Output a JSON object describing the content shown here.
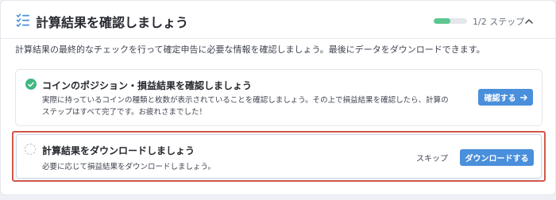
{
  "header": {
    "title": "計算結果を確認しましょう",
    "progress_fraction": 0.5,
    "step_text": "1/2 ステップ",
    "progress_color": "#5cc790"
  },
  "description": "計算結果の最終的なチェックを行って確定申告に必要な情報を確認しましょう。最後にデータをダウンロードできます。",
  "steps": [
    {
      "status": "completed",
      "title": "コインのポジション・損益結果を確認しましょう",
      "description": "実際に持っているコインの種類と枚数が表示されていることを確認しましょう。その上で損益結果を確認したら、計算のステップはすべて完了です。お疲れさまでした！",
      "button_label": "確認する",
      "button_icon": "arrow-right-icon"
    },
    {
      "status": "pending",
      "title": "計算結果をダウンロードしましょう",
      "description": "必要に応じて損益結果をダウンロードしましょう。",
      "skip_label": "スキップ",
      "button_label": "ダウンロードする"
    }
  ],
  "colors": {
    "accent": "#4a8fdb",
    "success": "#42b77f",
    "highlight_border": "#d2574b"
  }
}
